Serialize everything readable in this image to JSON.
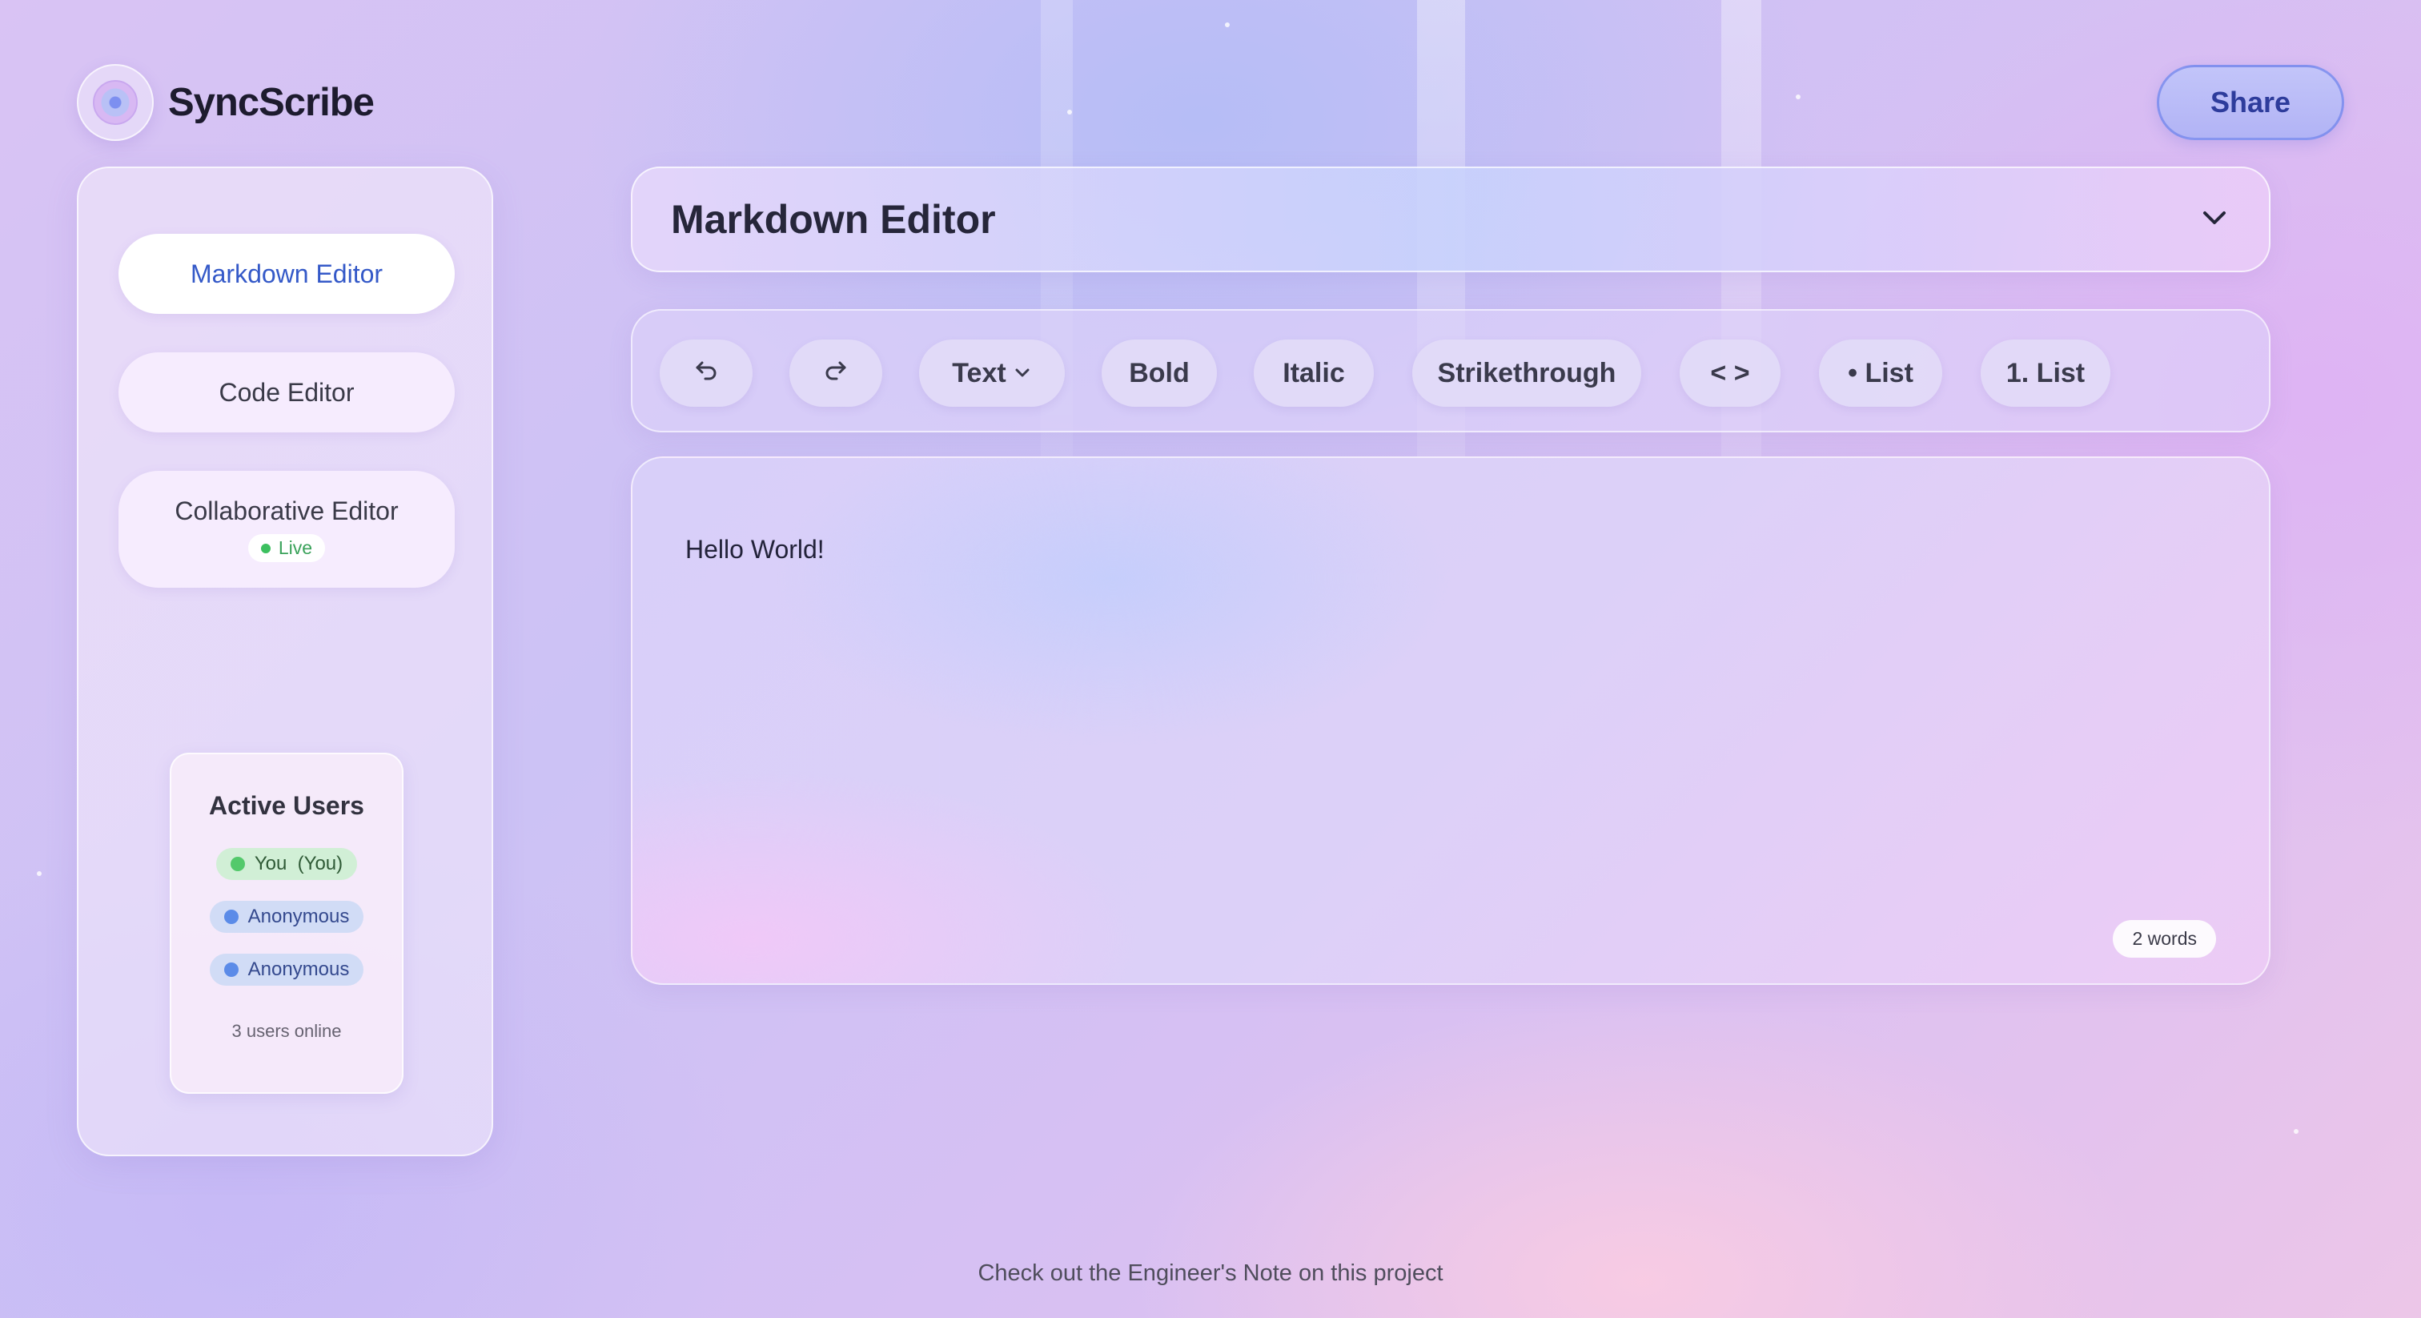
{
  "app": {
    "name": "SyncScribe",
    "share_label": "Share"
  },
  "sidebar": {
    "items": [
      {
        "label": "Markdown Editor",
        "active": true
      },
      {
        "label": "Code Editor"
      },
      {
        "label": "Collaborative Editor",
        "badge": "Live"
      }
    ]
  },
  "active_users": {
    "title": "Active Users",
    "users": [
      {
        "name": "You  (You)",
        "color": "#53c96b"
      },
      {
        "name": "Anonymous",
        "color": "#5b8be8"
      },
      {
        "name": "Anonymous",
        "color": "#5b8be8"
      }
    ],
    "count_text": "3 users online"
  },
  "editor_select": {
    "title": "Markdown Editor"
  },
  "toolbar": {
    "text_label": "Text",
    "bold": "Bold",
    "italic": "Italic",
    "strikethrough": "Strikethrough",
    "code": "< >",
    "bullet_list": "• List",
    "numbered_list": "1. List"
  },
  "editor": {
    "content": "Hello World!",
    "word_count": "2 words"
  },
  "footer": {
    "note": "Check out the Engineer's Note on this project"
  },
  "colors": {
    "accent": "#3459c8",
    "live": "#3cc05f",
    "share_border": "#6e82eb"
  }
}
